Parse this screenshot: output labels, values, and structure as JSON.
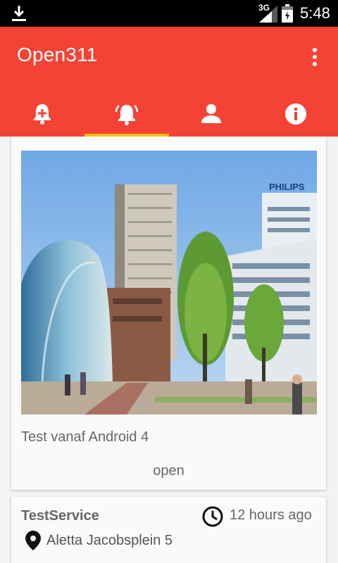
{
  "status_bar": {
    "network": "3G",
    "time": "5:48"
  },
  "app_bar": {
    "title": "Open311",
    "color": "#f44336",
    "overflow_icon": "more-vert-icon"
  },
  "tabs": [
    {
      "icon": "add-alert-icon",
      "active": false
    },
    {
      "icon": "alarm-bell-icon",
      "active": true
    },
    {
      "icon": "person-icon",
      "active": false
    },
    {
      "icon": "info-icon",
      "active": false
    }
  ],
  "tab_indicator_color": "#ffc107",
  "reports": [
    {
      "description": "Test vanaf Android 4",
      "status": "open"
    },
    {
      "service": "TestService",
      "time_ago": "12 hours ago",
      "address": "Aletta Jacobsplein 5"
    }
  ]
}
